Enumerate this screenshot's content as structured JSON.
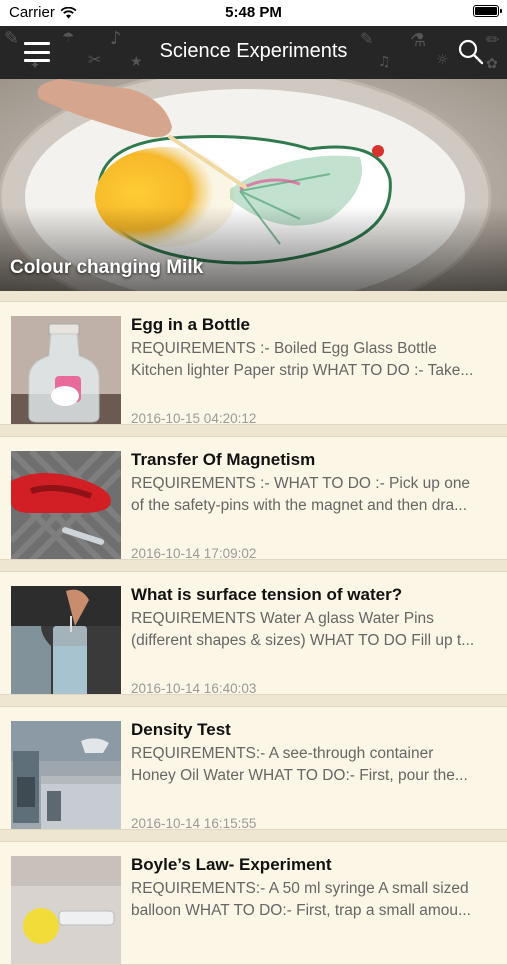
{
  "status_bar": {
    "carrier": "Carrier",
    "time": "5:48 PM"
  },
  "header": {
    "title": "Science Experiments",
    "menu_icon": "hamburger-menu-icon",
    "search_icon": "search-icon",
    "background": "#262626"
  },
  "featured": {
    "caption": "Colour changing Milk"
  },
  "items": [
    {
      "title": "Egg in a Bottle",
      "line1": "REQUIREMENTS :- Boiled Egg Glass Bottle",
      "line2": "Kitchen lighter Paper strip WHAT TO DO :- Take...",
      "date": "2016-10-15 04:20:12"
    },
    {
      "title": "Transfer Of Magnetism",
      "line1": "REQUIREMENTS :- WHAT TO DO :- Pick up one",
      "line2": "of the safety-pins with the magnet and then dra...",
      "date": "2016-10-14 17:09:02"
    },
    {
      "title": "What is surface tension of water?",
      "line1": "REQUIREMENTS Water A glass Water Pins",
      "line2": "(different shapes & sizes) WHAT TO DO Fill up t...",
      "date": "2016-10-14 16:40:03"
    },
    {
      "title": "Density Test",
      "line1": "REQUIREMENTS:- A see-through container",
      "line2": "Honey Oil Water WHAT TO DO:- First, pour the...",
      "date": "2016-10-14 16:15:55"
    },
    {
      "title": "Boyle’s Law- Experiment",
      "line1": "REQUIREMENTS:- A 50 ml syringe A small sized",
      "line2": "balloon WHAT TO DO:- First, trap a small amou...",
      "date": ""
    }
  ],
  "colors": {
    "background": "#efe6d2",
    "card": "#fcf6e6",
    "title": "#111111",
    "desc": "#666666",
    "date": "#9a9a9a"
  }
}
